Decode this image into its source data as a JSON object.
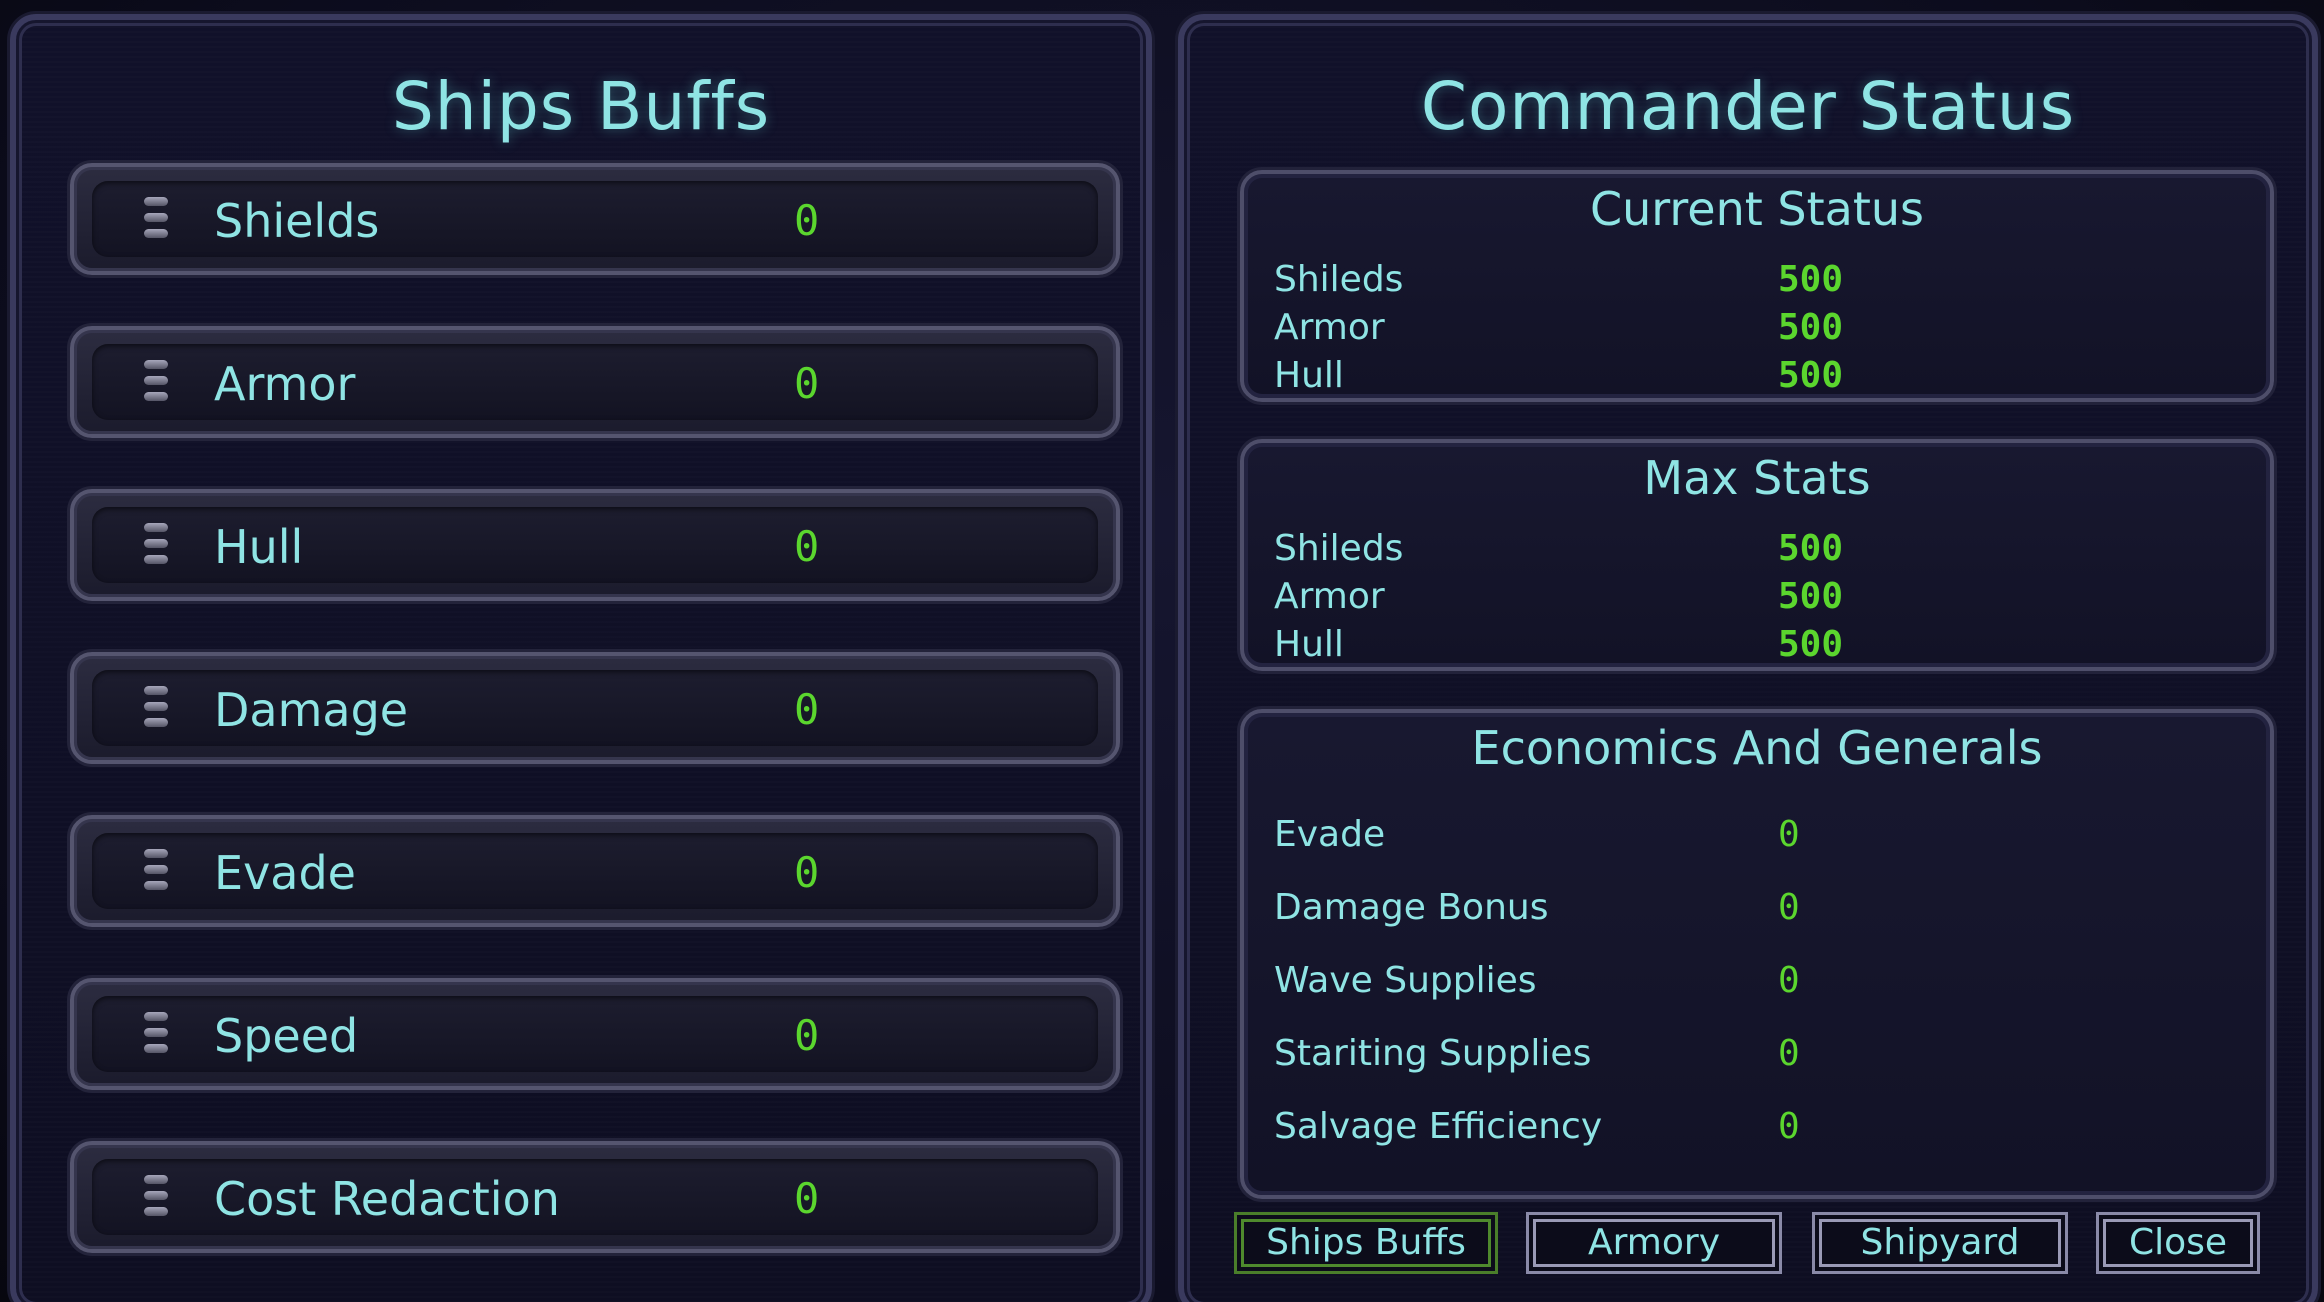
{
  "ships_buffs": {
    "title": "Ships Buffs",
    "items": [
      {
        "label": "Shields",
        "value": "0"
      },
      {
        "label": "Armor",
        "value": "0"
      },
      {
        "label": "Hull",
        "value": "0"
      },
      {
        "label": "Damage",
        "value": "0"
      },
      {
        "label": "Evade",
        "value": "0"
      },
      {
        "label": "Speed",
        "value": "0"
      },
      {
        "label": "Cost Redaction",
        "value": "0"
      }
    ]
  },
  "commander_status": {
    "title": "Commander Status",
    "current_status": {
      "title": "Current Status",
      "rows": [
        {
          "label": "Shileds",
          "value": "500"
        },
        {
          "label": "Armor",
          "value": "500"
        },
        {
          "label": "Hull",
          "value": "500"
        }
      ]
    },
    "max_stats": {
      "title": "Max Stats",
      "rows": [
        {
          "label": "Shileds",
          "value": "500"
        },
        {
          "label": "Armor",
          "value": "500"
        },
        {
          "label": "Hull",
          "value": "500"
        }
      ]
    },
    "economics": {
      "title": "Economics And Generals",
      "rows": [
        {
          "label": "Evade",
          "value": "0"
        },
        {
          "label": "Damage Bonus",
          "value": "0"
        },
        {
          "label": "Wave Supplies",
          "value": "0"
        },
        {
          "label": "Stariting Supplies",
          "value": "0"
        },
        {
          "label": "Salvage Efficiency",
          "value": "0"
        }
      ]
    }
  },
  "nav": {
    "ships_buffs": "Ships Buffs",
    "armory": "Armory",
    "shipyard": "Shipyard",
    "close": "Close",
    "active": "ships_buffs"
  }
}
